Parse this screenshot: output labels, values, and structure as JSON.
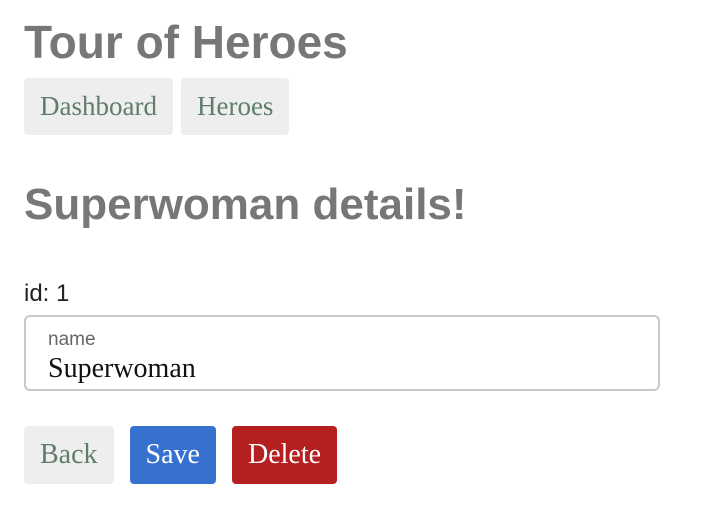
{
  "app": {
    "title": "Tour of Heroes"
  },
  "nav": {
    "items": [
      {
        "label": "Dashboard"
      },
      {
        "label": "Heroes"
      }
    ]
  },
  "hero": {
    "details_title": "Superwoman details!",
    "id_text": "id: 1",
    "name_label": "name",
    "name_value": "Superwoman"
  },
  "actions": {
    "back_label": "Back",
    "save_label": "Save",
    "delete_label": "Delete"
  },
  "colors": {
    "heading": "#777777",
    "nav_text": "#607d6b",
    "nav_bg": "#eeeeee",
    "save_bg": "#3771cf",
    "delete_bg": "#b41f20"
  }
}
